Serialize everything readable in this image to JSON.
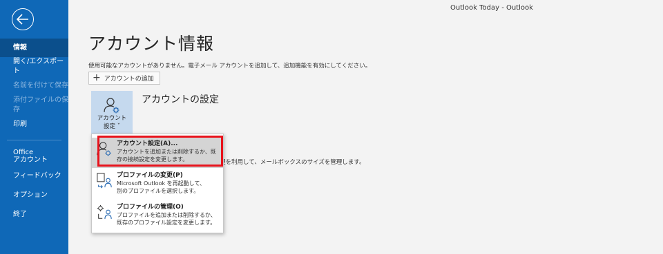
{
  "titlebar": {
    "text": "Outlook Today  -  Outlook"
  },
  "sidebar": {
    "items": [
      {
        "label": "情報",
        "state": "active"
      },
      {
        "label": "開く/エクスポート",
        "state": "normal"
      },
      {
        "label": "名前を付けて保存",
        "state": "disabled"
      },
      {
        "label": "添付ファイルの保存",
        "state": "disabled"
      },
      {
        "label": "印刷",
        "state": "normal"
      },
      {
        "label": "Office\nアカウント",
        "state": "normal"
      },
      {
        "label": "フィードバック",
        "state": "normal"
      },
      {
        "label": "オプション",
        "state": "normal"
      },
      {
        "label": "終了",
        "state": "normal"
      }
    ]
  },
  "main": {
    "title": "アカウント情報",
    "notice": "使用可能なアカウントがありません。電子メール アカウントを追加して、追加機能を有効にしてください。",
    "add_account_label": "アカウントの追加",
    "account_tile": {
      "line1": "アカウント",
      "line2": "設定 ˇ"
    },
    "section_title": "アカウントの設定",
    "mailbox_desc": "理を利用して、メールボックスのサイズを管理します。"
  },
  "dropdown": {
    "items": [
      {
        "title": "アカウント設定(A)...",
        "desc1": "アカウントを追加または削除するか、既",
        "desc2": "存の接続設定を変更します。",
        "icon": "account-settings-icon"
      },
      {
        "title": "プロファイルの変更(P)",
        "desc1": "Microsoft Outlook を再起動して、",
        "desc2": "別のプロファイルを選択します。",
        "icon": "profile-change-icon"
      },
      {
        "title": "プロファイルの管理(O)",
        "desc1": "プロファイルを追加または削除するか、",
        "desc2": "既存のプロファイル設定を変更します。",
        "icon": "profile-manage-icon"
      }
    ]
  },
  "colors": {
    "sidebar": "#0f68b7",
    "sidebar_active": "#0b4f8c",
    "highlight": "#e8121b",
    "tile": "#c5d9ee"
  }
}
